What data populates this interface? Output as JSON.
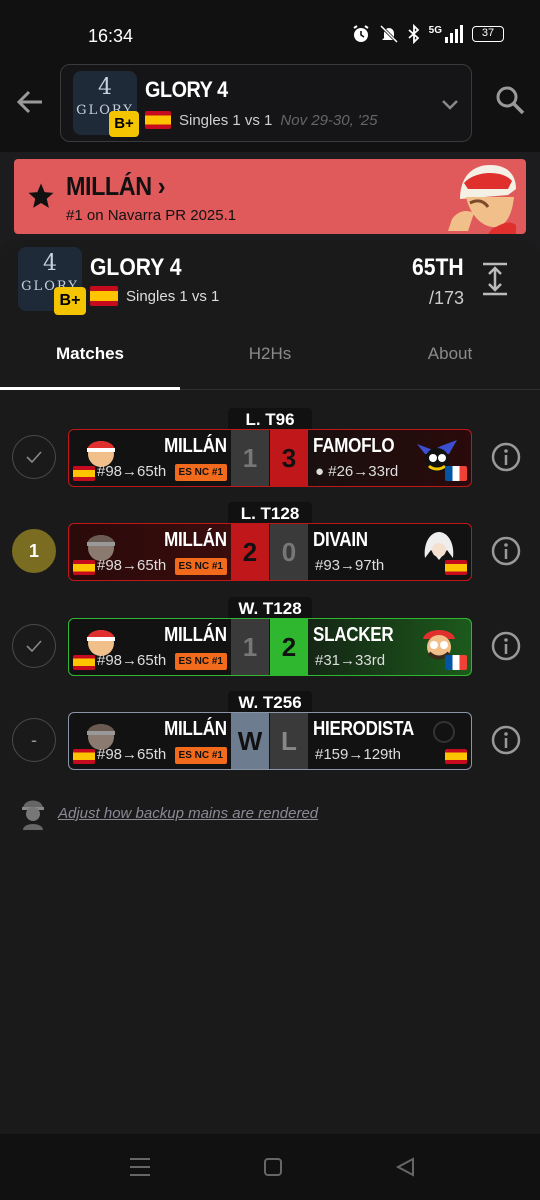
{
  "status_bar": {
    "time": "16:34",
    "network": "5G",
    "battery": "37"
  },
  "header": {
    "event_title": "GLORY 4",
    "logo_number": "4",
    "logo_text": "GLORY",
    "grade": "B+",
    "format": "Singles 1 vs 1",
    "dates": "Nov 29-30, '25"
  },
  "banner": {
    "player_name": "MILLÁN",
    "chevron": "›",
    "rank_text": "#1 on Navarra PR 2025.1",
    "background": "#e05a5c"
  },
  "tournament": {
    "title": "GLORY 4",
    "logo_number": "4",
    "logo_text": "GLORY",
    "grade": "B+",
    "format": "Singles 1 vs 1",
    "placement": "65TH",
    "total": "/173"
  },
  "tabs": [
    {
      "label": "Matches",
      "active": true
    },
    {
      "label": "H2Hs",
      "active": false
    },
    {
      "label": "About",
      "active": false
    }
  ],
  "matches": [
    {
      "round": "L. T96",
      "status": "check",
      "p1": {
        "name": "MILLÁN",
        "seed": "#98→65th",
        "badge": "ES NC #1"
      },
      "score1": "1",
      "score2": "3",
      "p2": {
        "name": "FAMOFLO",
        "seed": "● #26→33rd",
        "flag": "FR"
      }
    },
    {
      "round": "L. T128",
      "status": "1",
      "p1": {
        "name": "MILLÁN",
        "seed": "#98→65th",
        "badge": "ES NC #1"
      },
      "score1": "2",
      "score2": "0",
      "p2": {
        "name": "DIVAIN",
        "seed": "#93→97th",
        "flag": "ES"
      }
    },
    {
      "round": "W. T128",
      "status": "check",
      "p1": {
        "name": "MILLÁN",
        "seed": "#98→65th",
        "badge": "ES NC #1"
      },
      "score1": "1",
      "score2": "2",
      "p2": {
        "name": "SLACKER",
        "seed": "#31→33rd",
        "flag": "FR"
      }
    },
    {
      "round": "W. T256",
      "status": "-",
      "p1": {
        "name": "MILLÁN",
        "seed": "#98→65th",
        "badge": "ES NC #1"
      },
      "score1": "W",
      "score2": "L",
      "p2": {
        "name": "HIERODISTA",
        "seed": "#159→129th",
        "flag": "ES"
      }
    }
  ],
  "backup_link": "Adjust how backup mains are rendered",
  "colors": {
    "loss_red": "#c0171b",
    "win_green": "#2fb82f",
    "grade_yellow": "#f5c400",
    "pr_badge_orange": "#f26b1d"
  }
}
